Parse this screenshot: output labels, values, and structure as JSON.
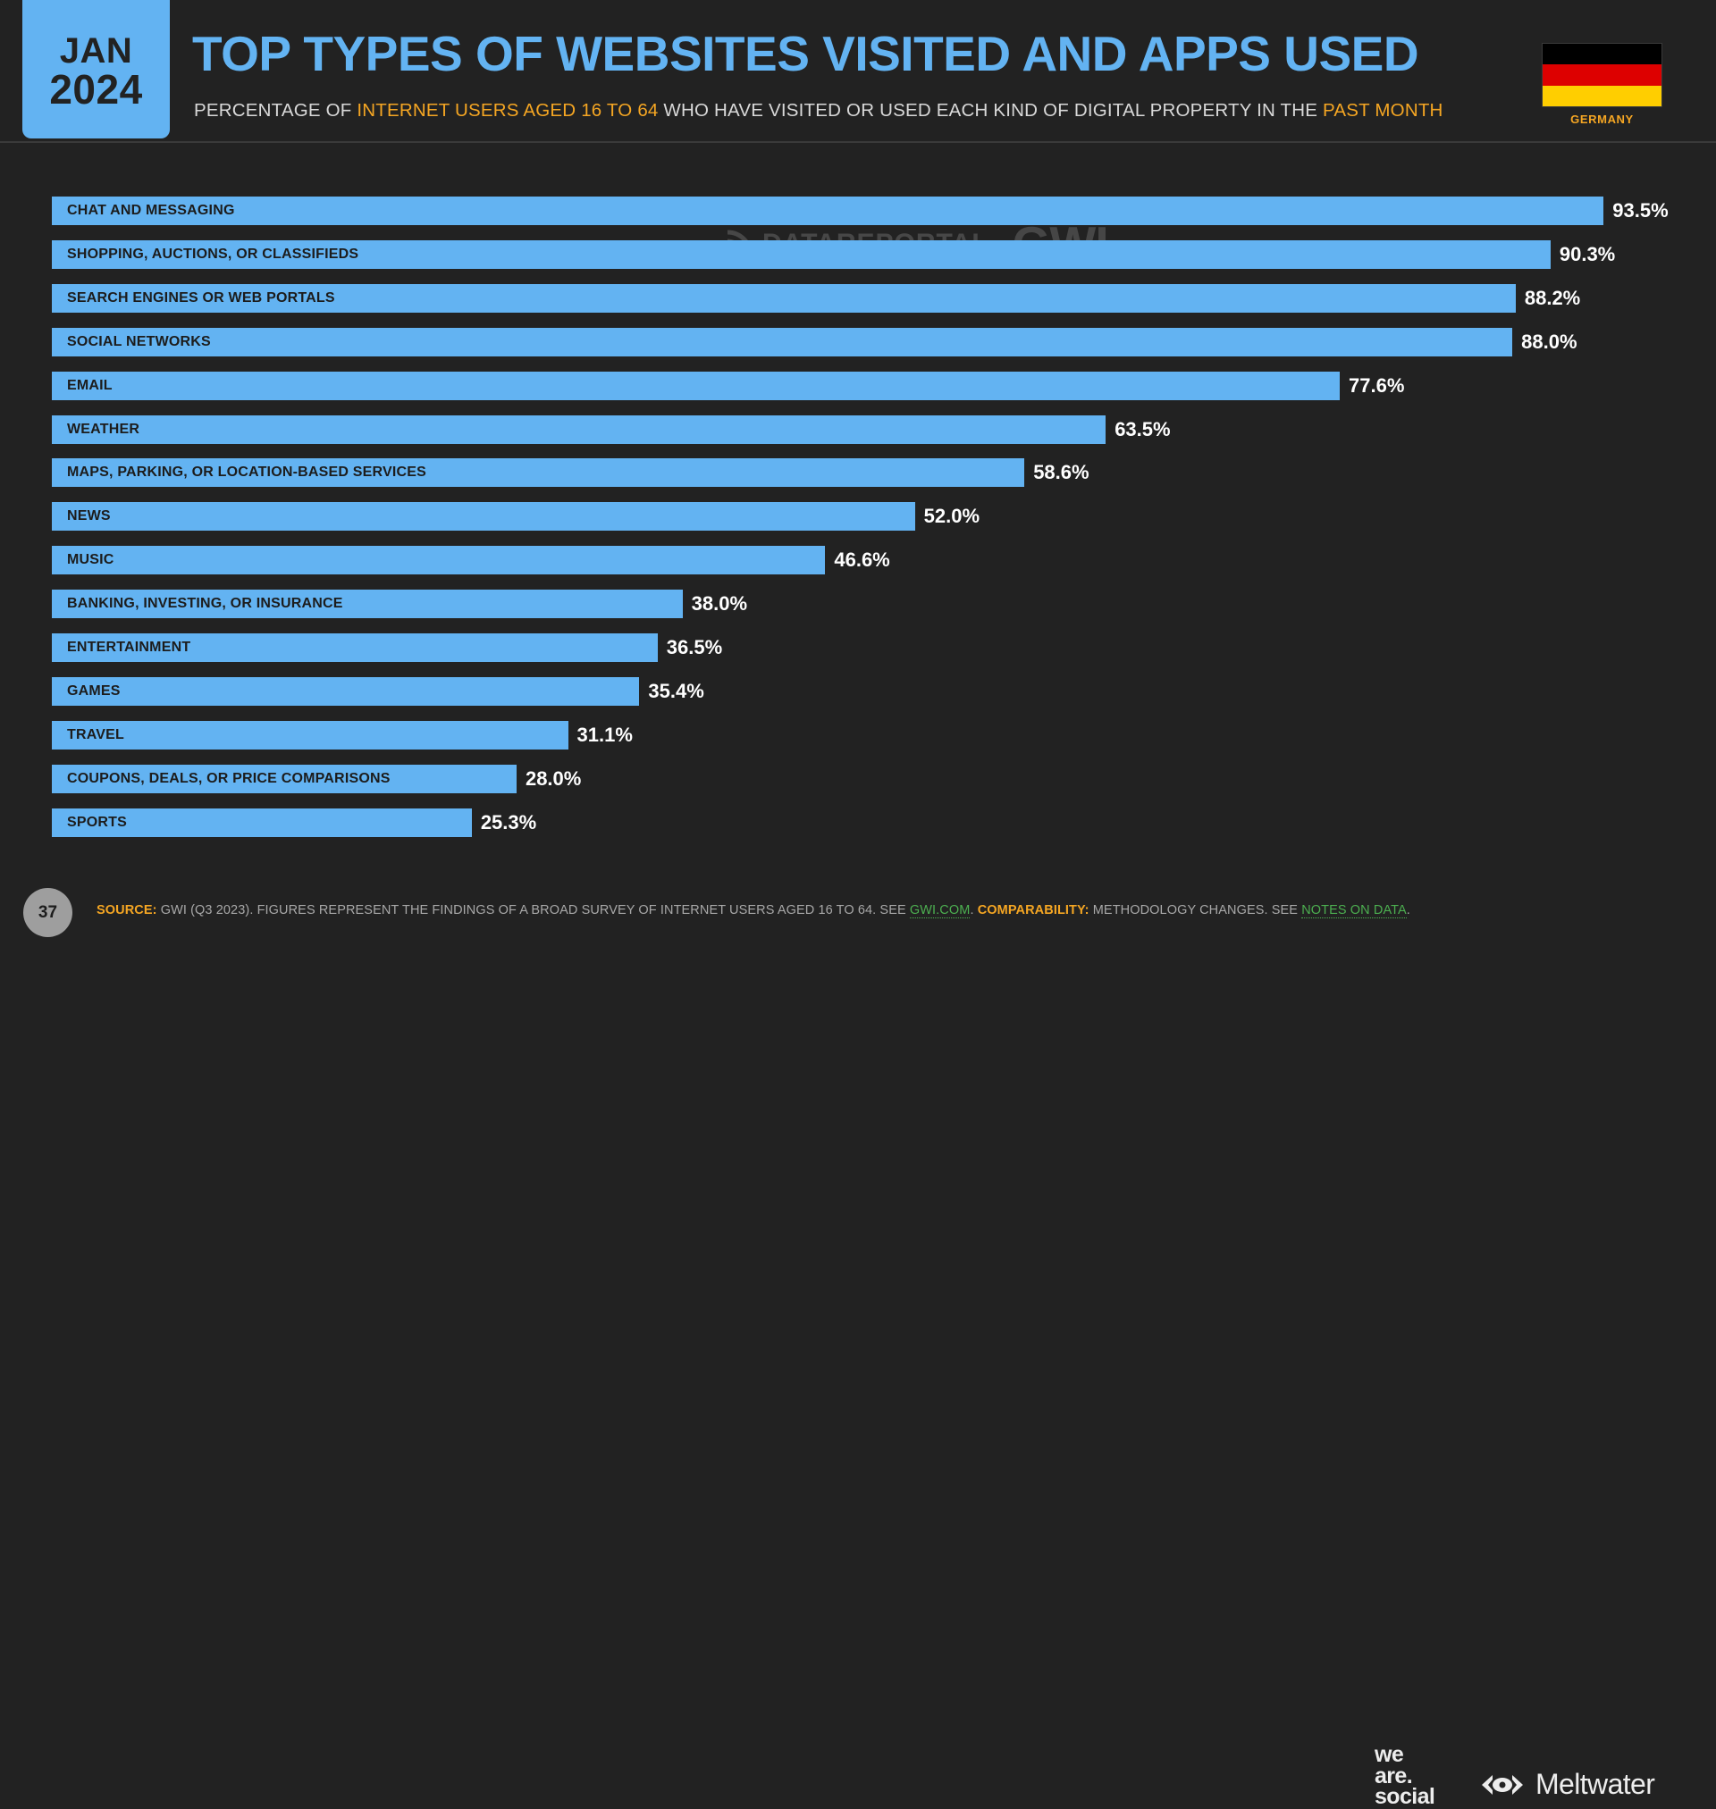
{
  "header": {
    "date_month": "JAN",
    "date_year": "2024",
    "title": "TOP TYPES OF WEBSITES VISITED AND APPS USED",
    "subtitle_pre": "PERCENTAGE OF ",
    "subtitle_hl1": "INTERNET USERS AGED 16 TO 64",
    "subtitle_mid": " WHO HAVE VISITED OR USED EACH KIND OF DIGITAL PROPERTY IN THE ",
    "subtitle_hl2": "PAST MONTH",
    "country": "GERMANY",
    "flag_colors": [
      "#000000",
      "#dd0000",
      "#ffce00"
    ],
    "accent_blue": "#63b3f2",
    "accent_orange": "#f5a623"
  },
  "watermark": {
    "datareportal": "DATAREPORTAL",
    "gwi": "GWI."
  },
  "chart_data": {
    "type": "bar",
    "title": "TOP TYPES OF WEBSITES VISITED AND APPS USED",
    "subtitle": "PERCENTAGE OF INTERNET USERS AGED 16 TO 64 WHO HAVE VISITED OR USED EACH KIND OF DIGITAL PROPERTY IN THE PAST MONTH",
    "orientation": "horizontal",
    "xlabel": "",
    "ylabel": "",
    "xlim": [
      0,
      100
    ],
    "grid": false,
    "legend": null,
    "bar_color": "#63b3f2",
    "value_suffix": "%",
    "categories": [
      "CHAT AND MESSAGING",
      "SHOPPING, AUCTIONS, OR CLASSIFIEDS",
      "SEARCH ENGINES OR WEB PORTALS",
      "SOCIAL NETWORKS",
      "EMAIL",
      "WEATHER",
      "MAPS, PARKING, OR LOCATION-BASED SERVICES",
      "NEWS",
      "MUSIC",
      "BANKING, INVESTING, OR INSURANCE",
      "ENTERTAINMENT",
      "GAMES",
      "TRAVEL",
      "COUPONS, DEALS, OR PRICE COMPARISONS",
      "SPORTS"
    ],
    "values": [
      93.5,
      90.3,
      88.2,
      88.0,
      77.6,
      63.5,
      58.6,
      52.0,
      46.6,
      38.0,
      36.5,
      35.4,
      31.1,
      28.0,
      25.3
    ],
    "value_labels": [
      "93.5%",
      "90.3%",
      "88.2%",
      "88.0%",
      "77.6%",
      "63.5%",
      "58.6%",
      "52.0%",
      "46.6%",
      "38.0%",
      "36.5%",
      "35.4%",
      "31.1%",
      "28.0%",
      "25.3%"
    ]
  },
  "footer": {
    "page_number": "37",
    "source_key": "SOURCE:",
    "source_text": " GWI (Q3 2023). FIGURES REPRESENT THE FINDINGS OF A BROAD SURVEY OF INTERNET USERS AGED 16 TO 64. SEE ",
    "source_link": "GWI.COM",
    "source_mid": ". ",
    "comparability_key": "COMPARABILITY:",
    "comparability_text": " METHODOLOGY CHANGES. SEE ",
    "comparability_link": "NOTES ON DATA",
    "source_end": ".",
    "brand_we_are_social": [
      "we",
      "are.",
      "social"
    ],
    "brand_meltwater": "Meltwater"
  }
}
